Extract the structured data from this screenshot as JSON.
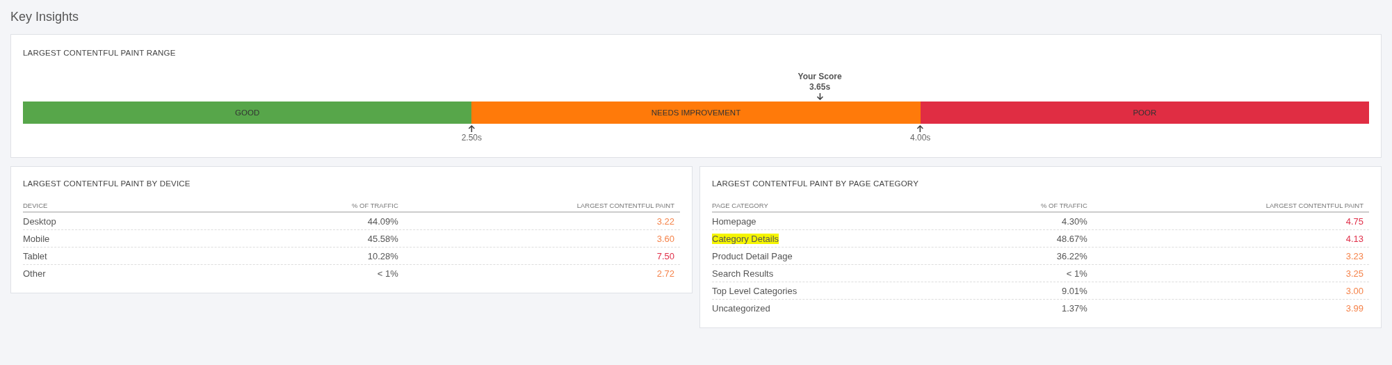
{
  "page_title": "Key Insights",
  "range": {
    "title": "LARGEST CONTENTFUL PAINT RANGE",
    "segments": [
      {
        "label": "GOOD",
        "color": "#57a64a"
      },
      {
        "label": "NEEDS IMPROVEMENT",
        "color": "#ff7a0a"
      },
      {
        "label": "POOR",
        "color": "#e02d43"
      }
    ],
    "thresholds": [
      "2.50s",
      "4.00s"
    ],
    "score": {
      "label": "Your Score",
      "value": "3.65s",
      "level": 0.592
    }
  },
  "tables": [
    {
      "title": "LARGEST CONTENTFUL PAINT BY DEVICE",
      "columns": [
        "DEVICE",
        "% OF TRAFFIC",
        "LARGEST CONTENTFUL PAINT"
      ],
      "rows": [
        {
          "name": "Desktop",
          "traffic": "44.09%",
          "lcp": "3.22",
          "color": "#f5834a",
          "highlighted": false
        },
        {
          "name": "Mobile",
          "traffic": "45.58%",
          "lcp": "3.60",
          "color": "#f5834a",
          "highlighted": false
        },
        {
          "name": "Tablet",
          "traffic": "10.28%",
          "lcp": "7.50",
          "color": "#e0304a",
          "highlighted": false
        },
        {
          "name": "Other",
          "traffic": "< 1%",
          "lcp": "2.72",
          "color": "#f5834a",
          "highlighted": false
        }
      ]
    },
    {
      "title": "LARGEST CONTENTFUL PAINT BY PAGE CATEGORY",
      "columns": [
        "PAGE CATEGORY",
        "% OF TRAFFIC",
        "LARGEST CONTENTFUL PAINT"
      ],
      "rows": [
        {
          "name": "Homepage",
          "traffic": "4.30%",
          "lcp": "4.75",
          "color": "#e0304a",
          "highlighted": false
        },
        {
          "name": "Category Details",
          "traffic": "48.67%",
          "lcp": "4.13",
          "color": "#e0304a",
          "highlighted": true
        },
        {
          "name": "Product Detail Page",
          "traffic": "36.22%",
          "lcp": "3.23",
          "color": "#f5834a",
          "highlighted": false
        },
        {
          "name": "Search Results",
          "traffic": "< 1%",
          "lcp": "3.25",
          "color": "#f5834a",
          "highlighted": false
        },
        {
          "name": "Top Level Categories",
          "traffic": "9.01%",
          "lcp": "3.00",
          "color": "#f5834a",
          "highlighted": false
        },
        {
          "name": "Uncategorized",
          "traffic": "1.37%",
          "lcp": "3.99",
          "color": "#f5834a",
          "highlighted": false
        }
      ]
    }
  ]
}
